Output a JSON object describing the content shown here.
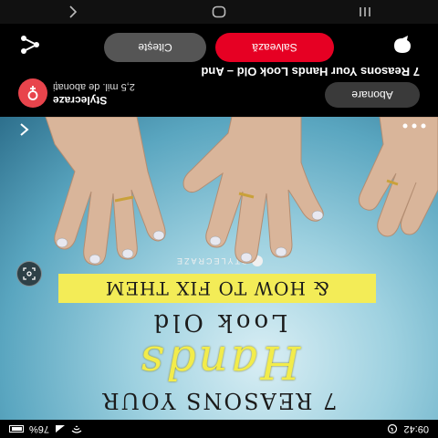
{
  "status_bar": {
    "time": "09:42",
    "battery": "76%"
  },
  "pin": {
    "heading_line1": "7 REASONS YOUR",
    "heading_line2": "Hands",
    "heading_line3": "Look Old",
    "banner": "& HOW TO FIX THEM",
    "brand": "STYLECRAZE",
    "icons": {
      "more": "more-icon",
      "back": "back-arrow-icon",
      "visual_search": "lens-icon"
    }
  },
  "creator": {
    "name": "Stylecraze",
    "followers": "2,5 mil. de abonați",
    "follow_label": "Abonare",
    "avatar_color": "#e8444c"
  },
  "title": "7 Reasons Your Hands Look Old – And",
  "actions": {
    "read_label": "Citește",
    "save_label": "Salvează",
    "save_color": "#e60023"
  },
  "navbar": {
    "icons": [
      "recents-icon",
      "home-icon",
      "back-icon"
    ]
  }
}
